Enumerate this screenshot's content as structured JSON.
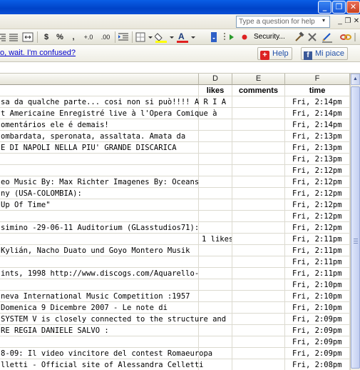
{
  "window": {
    "minimize_label": "_",
    "restore_label": "❐",
    "close_label": "✕"
  },
  "menu": {
    "help_placeholder": "Type a question for help",
    "help_dropdown": "▾",
    "doc_minimize": "_",
    "doc_restore": "❐",
    "doc_close": "✕"
  },
  "toolbar": {
    "currency": "$",
    "percent": "%",
    "comma": ",",
    "inc_decimal": "+.0",
    "dec_decimal": ".00",
    "security_label": "Security..."
  },
  "links": {
    "question_text": "o, wait.  I'm confused?",
    "aiuto_label": "Help",
    "mipiace_label": "Mi piace"
  },
  "columns": {
    "D": "D",
    "E": "E",
    "F": "F"
  },
  "header_row": {
    "likes": "likes",
    "comments": "comments",
    "time": "time"
  },
  "rows": [
    {
      "text": "sa da qualche parte... cosi non si può!!!! A R I A",
      "likes": "",
      "comments": "",
      "time": "Fri,  2:14pm"
    },
    {
      "text": "t Americaine Enregistré live à l'Opera Comique à",
      "likes": "",
      "comments": "",
      "time": "Fri,  2:14pm"
    },
    {
      "text": "omentários ele é demais!",
      "likes": "",
      "comments": "",
      "time": "Fri,  2:14pm"
    },
    {
      "text": "ombardata, speronata, assaltata. Amata da",
      "likes": "",
      "comments": "",
      "time": "Fri,  2:13pm"
    },
    {
      "text": "E DI NAPOLI NELLA PIU' GRANDE DISCARICA",
      "likes": "",
      "comments": "",
      "time": "Fri,  2:13pm"
    },
    {
      "text": "",
      "likes": "",
      "comments": "",
      "time": "Fri,  2:13pm"
    },
    {
      "text": "",
      "likes": "",
      "comments": "",
      "time": "Fri,  2:12pm"
    },
    {
      "text": "eo Music By: Max Richter Imagenes By: Oceans",
      "likes": "",
      "comments": "",
      "time": "Fri,  2:12pm"
    },
    {
      "text": "ny (USA-COLOMBIA):",
      "likes": "",
      "comments": "",
      "time": "Fri,  2:12pm"
    },
    {
      "text": "Up Of Time\"",
      "likes": "",
      "comments": "",
      "time": "Fri,  2:12pm"
    },
    {
      "text": "",
      "likes": "",
      "comments": "",
      "time": "Fri,  2:12pm"
    },
    {
      "text": "simino -29-06-11 Auditorium (GLasstudios71):",
      "likes": "",
      "comments": "",
      "time": "Fri,  2:12pm"
    },
    {
      "text": "",
      "likes": "1 likes",
      "comments": "",
      "time": "Fri,  2:11pm"
    },
    {
      "text": " Kylián, Nacho Duato und Goyo Montero Musik",
      "likes": "",
      "comments": "",
      "time": "Fri,  2:11pm"
    },
    {
      "text": "",
      "likes": "",
      "comments": "",
      "time": "Fri,  2:11pm"
    },
    {
      "text": "ints, 1998 http://www.discogs.com/Aquarello-",
      "likes": "",
      "comments": "",
      "time": "Fri,  2:11pm"
    },
    {
      "text": "",
      "likes": "",
      "comments": "",
      "time": "Fri,  2:10pm"
    },
    {
      "text": "neva International Music Competition :1957",
      "likes": "",
      "comments": "",
      "time": "Fri,  2:10pm"
    },
    {
      "text": "Domenica 9 Dicembre 2007 - Le note di",
      "likes": "",
      "comments": "",
      "time": "Fri,  2:10pm"
    },
    {
      "text": "SYSTEM V is closely connected to the structure and",
      "likes": "",
      "comments": "",
      "time": "Fri,  2:09pm"
    },
    {
      "text": "RE REGIA DANIELE SALVO :",
      "likes": "",
      "comments": "",
      "time": "Fri,  2:09pm"
    },
    {
      "text": "",
      "likes": "",
      "comments": "",
      "time": "Fri,  2:09pm"
    },
    {
      "text": "8-09: Il video vincitore del contest Romaeuropa",
      "likes": "",
      "comments": "",
      "time": "Fri,  2:09pm"
    },
    {
      "text": "lletti - Official site of Alessandra Celletti",
      "likes": "",
      "comments": "",
      "time": "Fri,  2:08pm"
    },
    {
      "text": "",
      "likes": "",
      "comments": "",
      "time": ""
    }
  ]
}
